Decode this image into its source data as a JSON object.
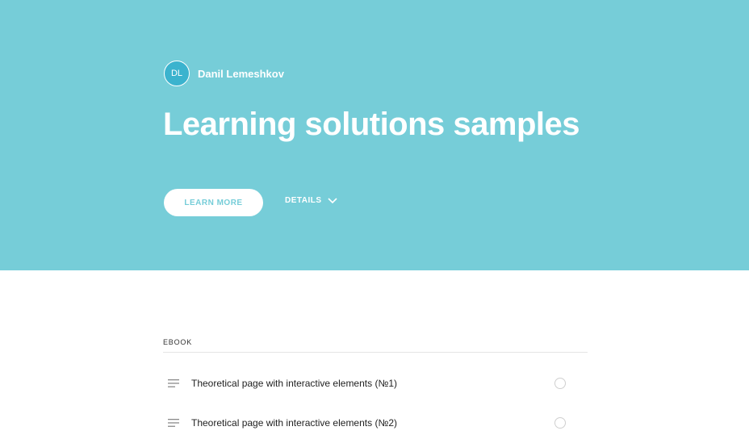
{
  "hero": {
    "author": {
      "initials": "DL",
      "name": "Danil Lemeshkov"
    },
    "title": "Learning solutions samples",
    "learn_more_label": "LEARN MORE",
    "details_label": "DETAILS",
    "background_color": "#76cdd8",
    "avatar_color": "#3bb3ce"
  },
  "content": {
    "section_label": "EBOOK",
    "lessons": [
      {
        "title": "Theoretical page with interactive elements (№1)",
        "icon": "list-icon",
        "status_icon": "empty-circle-icon"
      },
      {
        "title": "Theoretical page with interactive elements (№2)",
        "icon": "list-icon",
        "status_icon": "empty-circle-icon"
      }
    ]
  }
}
